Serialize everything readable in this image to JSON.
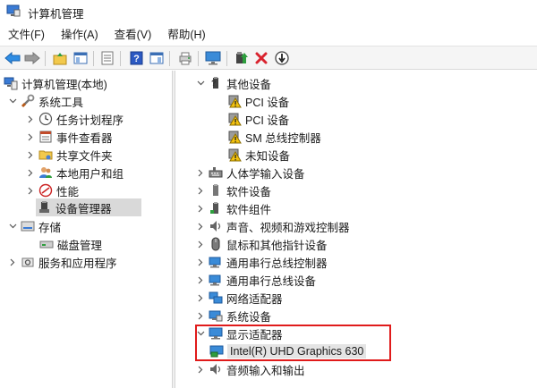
{
  "window": {
    "title": "计算机管理"
  },
  "menu": [
    "文件(F)",
    "操作(A)",
    "查看(V)",
    "帮助(H)"
  ],
  "left_tree": [
    {
      "label": "计算机管理(本地)",
      "level": 0,
      "expand": "none",
      "icon": "computer-mgmt-icon"
    },
    {
      "label": "系统工具",
      "level": 1,
      "expand": "open",
      "icon": "tools-icon"
    },
    {
      "label": "任务计划程序",
      "level": 2,
      "expand": "closed",
      "icon": "clock-icon"
    },
    {
      "label": "事件查看器",
      "level": 2,
      "expand": "closed",
      "icon": "event-viewer-icon"
    },
    {
      "label": "共享文件夹",
      "level": 2,
      "expand": "closed",
      "icon": "shared-folder-icon"
    },
    {
      "label": "本地用户和组",
      "level": 2,
      "expand": "closed",
      "icon": "users-icon"
    },
    {
      "label": "性能",
      "level": 2,
      "expand": "closed",
      "icon": "performance-icon"
    },
    {
      "label": "设备管理器",
      "level": 2,
      "expand": "none",
      "icon": "device-manager-icon",
      "selected": true
    },
    {
      "label": "存储",
      "level": 1,
      "expand": "open",
      "icon": "storage-icon"
    },
    {
      "label": "磁盘管理",
      "level": 2,
      "expand": "none",
      "icon": "disk-icon"
    },
    {
      "label": "服务和应用程序",
      "level": 1,
      "expand": "closed",
      "icon": "services-icon"
    }
  ],
  "right_tree": [
    {
      "label": "其他设备",
      "level": 0,
      "expand": "open",
      "icon": "unknown-device-icon"
    },
    {
      "label": "PCI 设备",
      "level": 1,
      "expand": "none",
      "icon": "warning-device-icon"
    },
    {
      "label": "PCI 设备",
      "level": 1,
      "expand": "none",
      "icon": "warning-device-icon"
    },
    {
      "label": "SM 总线控制器",
      "level": 1,
      "expand": "none",
      "icon": "warning-device-icon"
    },
    {
      "label": "未知设备",
      "level": 1,
      "expand": "none",
      "icon": "warning-device-icon"
    },
    {
      "label": "人体学输入设备",
      "level": 0,
      "expand": "closed",
      "icon": "hid-icon"
    },
    {
      "label": "软件设备",
      "level": 0,
      "expand": "closed",
      "icon": "software-device-icon"
    },
    {
      "label": "软件组件",
      "level": 0,
      "expand": "closed",
      "icon": "software-component-icon"
    },
    {
      "label": "声音、视频和游戏控制器",
      "level": 0,
      "expand": "closed",
      "icon": "speaker-icon"
    },
    {
      "label": "鼠标和其他指针设备",
      "level": 0,
      "expand": "closed",
      "icon": "mouse-icon"
    },
    {
      "label": "通用串行总线控制器",
      "level": 0,
      "expand": "closed",
      "icon": "usb-icon"
    },
    {
      "label": "通用串行总线设备",
      "level": 0,
      "expand": "closed",
      "icon": "usb-icon"
    },
    {
      "label": "网络适配器",
      "level": 0,
      "expand": "closed",
      "icon": "network-icon"
    },
    {
      "label": "系统设备",
      "level": 0,
      "expand": "closed",
      "icon": "system-device-icon"
    },
    {
      "label": "显示适配器",
      "level": 0,
      "expand": "open",
      "icon": "monitor-icon"
    },
    {
      "label": "Intel(R) UHD Graphics 630",
      "level": 1,
      "expand": "none",
      "icon": "display-adapter-icon",
      "selected": true
    },
    {
      "label": "音频输入和输出",
      "level": 0,
      "expand": "closed",
      "icon": "audio-icon"
    }
  ],
  "colors": {
    "highlight": "#e01b1b",
    "accent": "#0a64c8"
  }
}
